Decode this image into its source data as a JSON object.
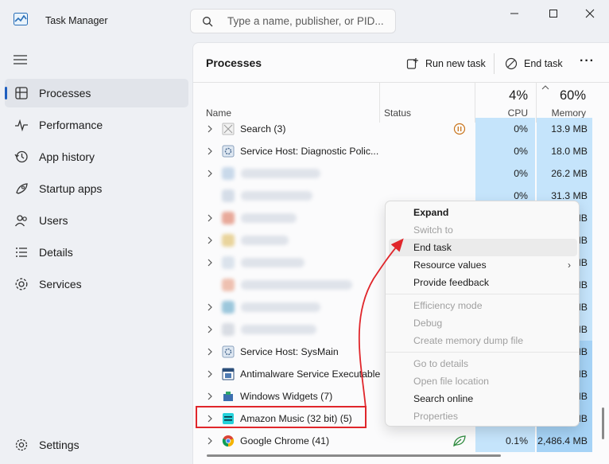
{
  "app": {
    "title": "Task Manager"
  },
  "search": {
    "placeholder": "Type a name, publisher, or PID..."
  },
  "window_controls": {
    "minimize": "minimize",
    "maximize": "maximize",
    "close": "close"
  },
  "sidebar": {
    "items": [
      {
        "label": "Processes",
        "icon": "processes-icon",
        "active": true
      },
      {
        "label": "Performance",
        "icon": "performance-icon"
      },
      {
        "label": "App history",
        "icon": "app-history-icon"
      },
      {
        "label": "Startup apps",
        "icon": "startup-apps-icon"
      },
      {
        "label": "Users",
        "icon": "users-icon"
      },
      {
        "label": "Details",
        "icon": "details-icon"
      },
      {
        "label": "Services",
        "icon": "services-icon"
      }
    ],
    "settings_label": "Settings"
  },
  "toolbar": {
    "page_title": "Processes",
    "run_new_task": "Run new task",
    "end_task": "End task"
  },
  "columns": {
    "name": "Name",
    "status": "Status",
    "cpu_pct": "4%",
    "cpu": "CPU",
    "mem_pct": "60%",
    "memory": "Memory"
  },
  "processes": [
    {
      "name": "Search (3)",
      "cpu": "0%",
      "mem": "13.9 MB",
      "expand": true,
      "status_icon": "paused"
    },
    {
      "name": "Service Host: Diagnostic Polic...",
      "cpu": "0%",
      "mem": "18.0 MB",
      "expand": true
    },
    {
      "name": "",
      "cpu": "0%",
      "mem": "26.2 MB",
      "expand": true,
      "blurred": true
    },
    {
      "name": "",
      "cpu": "0%",
      "mem": "31.3 MB",
      "expand": false,
      "blurred": true
    },
    {
      "name": "",
      "cpu": "",
      "mem": "MB",
      "expand": true,
      "blurred": true
    },
    {
      "name": "",
      "cpu": "",
      "mem": "MB",
      "expand": true,
      "blurred": true
    },
    {
      "name": "",
      "cpu": "",
      "mem": "MB",
      "expand": true,
      "blurred": true
    },
    {
      "name": "",
      "cpu": "",
      "mem": "MB",
      "expand": false,
      "blurred": true
    },
    {
      "name": "",
      "cpu": "",
      "mem": "MB",
      "expand": true,
      "blurred": true
    },
    {
      "name": "",
      "cpu": "",
      "mem": "MB",
      "expand": true,
      "blurred": true
    },
    {
      "name": "Service Host: SysMain",
      "cpu": "",
      "mem": "MB",
      "expand": true
    },
    {
      "name": "Antimalware Service Executable",
      "cpu": "",
      "mem": "MB",
      "expand": true
    },
    {
      "name": "Windows Widgets (7)",
      "cpu": "",
      "mem": "MB",
      "expand": true
    },
    {
      "name": "Amazon Music (32 bit) (5)",
      "cpu": "",
      "mem": "MB",
      "expand": true,
      "highlighted": true
    },
    {
      "name": "Google Chrome (41)",
      "cpu": "0.1%",
      "mem": "2,486.4 MB",
      "expand": true,
      "status_icon": "eco"
    }
  ],
  "context_menu": {
    "items": [
      {
        "label": "Expand",
        "disabled": false,
        "bold": true
      },
      {
        "label": "Switch to",
        "disabled": true
      },
      {
        "label": "End task",
        "disabled": false,
        "hover": true
      },
      {
        "label": "Resource values",
        "disabled": false,
        "submenu": true
      },
      {
        "label": "Provide feedback",
        "disabled": false
      },
      {
        "label": "Efficiency mode",
        "disabled": true,
        "sep_before": true
      },
      {
        "label": "Debug",
        "disabled": true
      },
      {
        "label": "Create memory dump file",
        "disabled": true
      },
      {
        "label": "Go to details",
        "disabled": true,
        "sep_before": true
      },
      {
        "label": "Open file location",
        "disabled": true
      },
      {
        "label": "Search online",
        "disabled": false
      },
      {
        "label": "Properties",
        "disabled": true
      }
    ]
  },
  "colors": {
    "accent": "#1f5fbf",
    "highlight_box": "#e0262b",
    "cpu_cell": "#c5e4fb",
    "mem_cell_dark": "#a6d3f6"
  }
}
